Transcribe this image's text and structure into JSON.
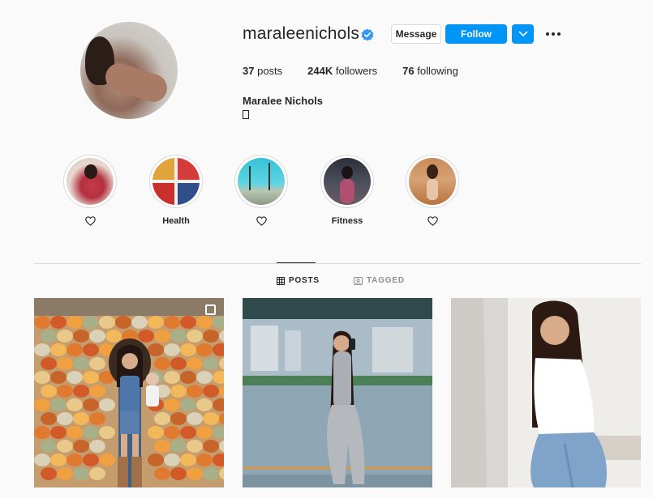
{
  "profile": {
    "username": "maraleenichols",
    "full_name": "Maralee Nichols",
    "bio": "▯",
    "verified": true,
    "message_label": "Message",
    "follow_label": "Follow",
    "stats": {
      "posts_count": "37",
      "posts_label": "posts",
      "followers_count": "244K",
      "followers_label": "followers",
      "following_count": "76",
      "following_label": "following"
    }
  },
  "highlights": [
    {
      "label": "",
      "icon": "heart-icon"
    },
    {
      "label": "Health",
      "icon": ""
    },
    {
      "label": "",
      "icon": "heart-icon"
    },
    {
      "label": "Fitness",
      "icon": ""
    },
    {
      "label": "",
      "icon": "heart-icon"
    }
  ],
  "tabs": {
    "posts": "POSTS",
    "tagged": "TAGGED"
  },
  "colors": {
    "accent": "#0095f6",
    "verified": "#3897f0",
    "divider": "#dbdbdb",
    "muted": "#8e8e8e"
  }
}
